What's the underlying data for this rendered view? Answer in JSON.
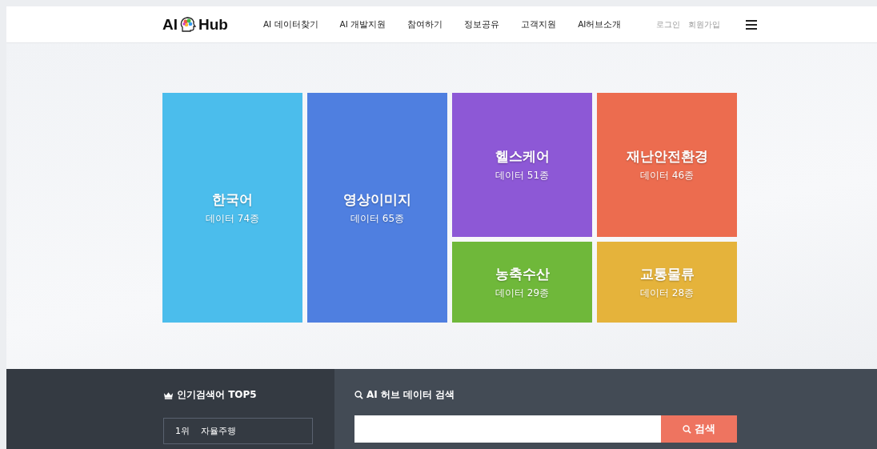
{
  "header": {
    "logo_left": "AI",
    "logo_right": "Hub",
    "nav": [
      "AI 데이터찾기",
      "AI 개발지원",
      "참여하기",
      "정보공유",
      "고객지원",
      "AI허브소개"
    ],
    "links": [
      "로그인",
      "회원가입"
    ]
  },
  "tiles": [
    {
      "title": "한국어",
      "count": "데이터 74종",
      "color": "#4bbdec",
      "kind": "tall"
    },
    {
      "title": "영상이미지",
      "count": "데이터 65종",
      "color": "#4f7fe0",
      "kind": "tall"
    },
    {
      "title": "헬스케어",
      "count": "데이터 51종",
      "color": "#8d58d6",
      "kind": "short"
    },
    {
      "title": "재난안전환경",
      "count": "데이터 46종",
      "color": "#ec6c4f",
      "kind": "short"
    },
    {
      "title": "농축수산",
      "count": "데이터 29종",
      "color": "#6fb83a",
      "kind": "short"
    },
    {
      "title": "교통물류",
      "count": "데이터 28종",
      "color": "#e5b33b",
      "kind": "short"
    }
  ],
  "popular": {
    "title": "인기검색어 TOP5",
    "items": [
      {
        "rank": "1위",
        "term": "자율주행"
      }
    ]
  },
  "search": {
    "title": "AI 허브 데이터 검색",
    "button": "검색"
  }
}
